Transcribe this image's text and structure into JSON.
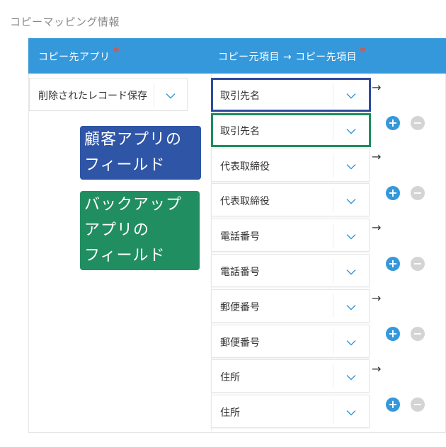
{
  "title": "コピーマッピング情報",
  "header": {
    "dest_app_label": "コピー先アプリ",
    "mapping_label": "コピー元項目 → コピー先項目",
    "required_mark": "*"
  },
  "dest_app": {
    "value": "削除されたレコード保存"
  },
  "mappings": [
    {
      "source": "取引先名",
      "dest": "取引先名"
    },
    {
      "source": "代表取締役",
      "dest": "代表取締役"
    },
    {
      "source": "電話番号",
      "dest": "電話番号"
    },
    {
      "source": "郵便番号",
      "dest": "郵便番号"
    },
    {
      "source": "住所",
      "dest": "住所"
    }
  ],
  "arrow_glyph": "→",
  "add_glyph": "+",
  "remove_glyph": "−",
  "annotations": {
    "customer": [
      "顧客アプリの",
      "フィールド"
    ],
    "backup": [
      "バックアップ",
      "アプリの",
      "フィールド"
    ]
  },
  "colors": {
    "header_bg": "#3498db",
    "required": "#e74c3c",
    "customer_note": "#2f55a7",
    "backup_note": "#218e61",
    "add_button": "#3498db",
    "remove_button": "#d4d4d4"
  }
}
